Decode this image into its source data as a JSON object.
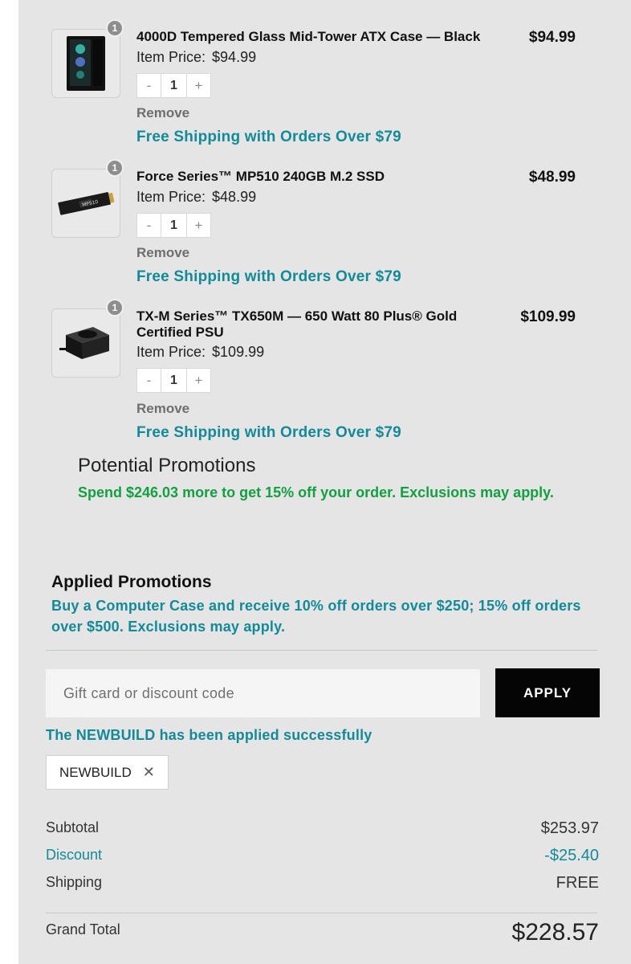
{
  "items": [
    {
      "name": "4000D Tempered Glass Mid-Tower ATX Case — Black",
      "price": "$94.99",
      "item_price_label": "Item Price:",
      "item_price": "$94.99",
      "qty": "1",
      "badge": "1",
      "minus": "-",
      "plus": "+",
      "remove": "Remove",
      "shipping": "Free Shipping with Orders Over $79",
      "thumb_icon": "pc-case-icon"
    },
    {
      "name": "Force Series™ MP510 240GB M.2 SSD",
      "price": "$48.99",
      "item_price_label": "Item Price:",
      "item_price": "$48.99",
      "qty": "1",
      "badge": "1",
      "minus": "-",
      "plus": "+",
      "remove": "Remove",
      "shipping": "Free Shipping with Orders Over $79",
      "thumb_icon": "ssd-icon"
    },
    {
      "name": "TX-M Series™ TX650M — 650 Watt 80 Plus® Gold Certified PSU",
      "price": "$109.99",
      "item_price_label": "Item Price:",
      "item_price": "$109.99",
      "qty": "1",
      "badge": "1",
      "minus": "-",
      "plus": "+",
      "remove": "Remove",
      "shipping": "Free Shipping with Orders Over $79",
      "thumb_icon": "psu-icon"
    }
  ],
  "potential": {
    "title": "Potential Promotions",
    "text": "Spend $246.03 more to get 15% off your order. Exclusions may apply."
  },
  "applied": {
    "title": "Applied Promotions",
    "text": "Buy a Computer Case and receive 10% off orders over $250; 15% off orders over $500. Exclusions may apply."
  },
  "discount_form": {
    "placeholder": "Gift card or discount code",
    "apply_label": "APPLY",
    "success": "The NEWBUILD has been applied successfully",
    "code_chip": "NEWBUILD",
    "remove_chip": "✕"
  },
  "summary": {
    "subtotal_label": "Subtotal",
    "subtotal": "$253.97",
    "discount_label": "Discount",
    "discount": "-$25.40",
    "shipping_label": "Shipping",
    "shipping": "FREE",
    "grand_total_label": "Grand Total",
    "grand_total": "$228.57"
  },
  "colors": {
    "teal": "#138a9a",
    "green": "#12a040",
    "panel": "#e5e5e5",
    "button": "#050505"
  }
}
